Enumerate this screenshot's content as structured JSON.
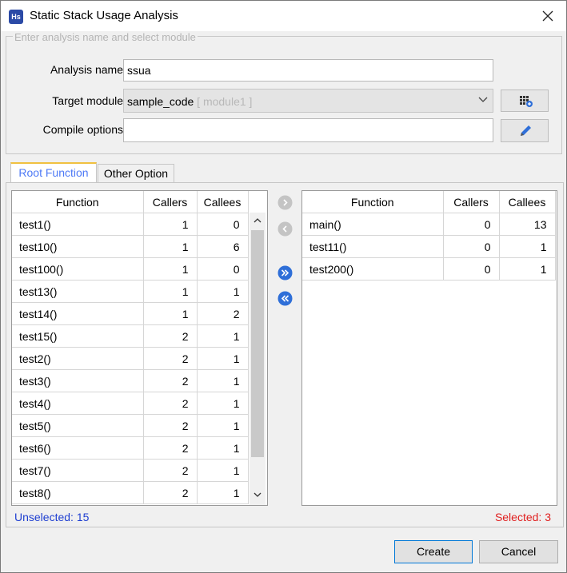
{
  "window": {
    "title": "Static Stack Usage Analysis",
    "app_icon_text": "Hs"
  },
  "form": {
    "group_title": "Enter analysis name and select module",
    "analysis_name_label": "Analysis name",
    "analysis_name_value": "ssua",
    "target_module_label": "Target module",
    "target_module_value": "sample_code",
    "target_module_hint": "[ module1 ]",
    "compile_options_label": "Compile options",
    "compile_options_value": ""
  },
  "tabs": [
    {
      "label": "Root Function",
      "active": true
    },
    {
      "label": "Other Option",
      "active": false
    }
  ],
  "columns": [
    "Function",
    "Callers",
    "Callees"
  ],
  "left_table": [
    [
      "test1()",
      "1",
      "0"
    ],
    [
      "test10()",
      "1",
      "6"
    ],
    [
      "test100()",
      "1",
      "0"
    ],
    [
      "test13()",
      "1",
      "1"
    ],
    [
      "test14()",
      "1",
      "2"
    ],
    [
      "test15()",
      "2",
      "1"
    ],
    [
      "test2()",
      "2",
      "1"
    ],
    [
      "test3()",
      "2",
      "1"
    ],
    [
      "test4()",
      "2",
      "1"
    ],
    [
      "test5()",
      "2",
      "1"
    ],
    [
      "test6()",
      "2",
      "1"
    ],
    [
      "test7()",
      "2",
      "1"
    ],
    [
      "test8()",
      "2",
      "1"
    ]
  ],
  "right_table": [
    [
      "main()",
      "0",
      "13"
    ],
    [
      "test11()",
      "0",
      "1"
    ],
    [
      "test200()",
      "0",
      "1"
    ]
  ],
  "status": {
    "unselected": "Unselected: 15",
    "selected": "Selected: 3",
    "unselected_color": "#1f3fd1",
    "selected_color": "#e02020"
  },
  "buttons": {
    "create": "Create",
    "cancel": "Cancel"
  }
}
